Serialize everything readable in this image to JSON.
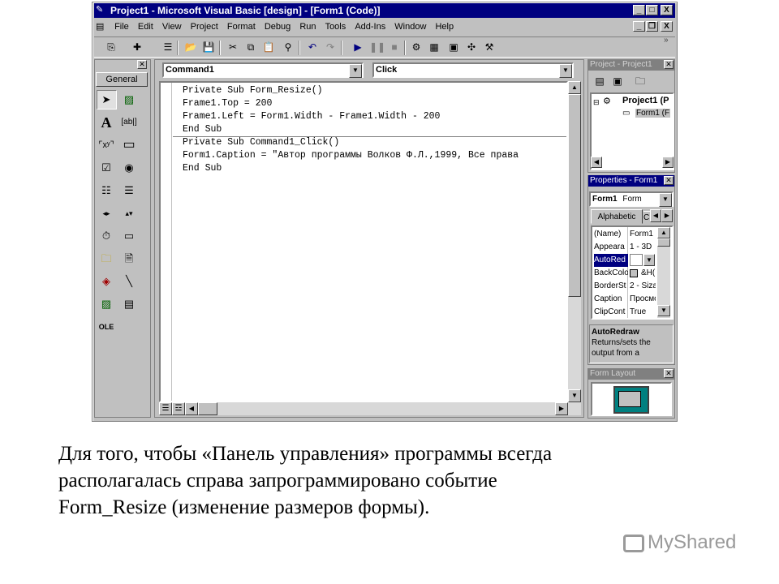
{
  "window": {
    "title": "Project1 - Microsoft Visual Basic [design] - [Form1 (Code)]",
    "controls": [
      "_",
      "□",
      "X"
    ],
    "inner_controls": [
      "_",
      "❐",
      "X"
    ]
  },
  "menu": [
    "File",
    "Edit",
    "View",
    "Project",
    "Format",
    "Debug",
    "Run",
    "Tools",
    "Add-Ins",
    "Window",
    "Help"
  ],
  "toolbox": {
    "tab_label": "General"
  },
  "code_window": {
    "object_combo": "Command1",
    "procedure_combo": "Click",
    "lines": [
      "Private Sub Form_Resize()",
      "Frame1.Top = 200",
      "Frame1.Left = Form1.Width - Frame1.Width - 200",
      "End Sub",
      "Private Sub Command1_Click()",
      "Form1.Caption = \"Автор программы Волков Ф.Л.,1999, Все права",
      "End Sub"
    ]
  },
  "project_explorer": {
    "title": "Project - Project1",
    "root": "Project1 (P",
    "child": "Form1 (F"
  },
  "properties": {
    "title": "Properties - Form1",
    "object_combo": "Form1",
    "object_type": "Form",
    "tab_alphabetic": "Alphabetic",
    "tab_categorized": "C",
    "rows": [
      {
        "name": "(Name)",
        "value": "Form1"
      },
      {
        "name": "Appeara",
        "value": "1 - 3D"
      },
      {
        "name": "AutoRed",
        "value": ""
      },
      {
        "name": "BackColo",
        "value": "&H("
      },
      {
        "name": "BorderSt",
        "value": "2 - Siza"
      },
      {
        "name": "Caption",
        "value": "Просмс"
      },
      {
        "name": "ClipCont",
        "value": "True"
      }
    ],
    "desc_title": "AutoRedraw",
    "desc_line1": "Returns/sets the",
    "desc_line2": "output from a"
  },
  "form_layout": {
    "title": "Form Layout"
  },
  "caption": {
    "line1": "Для того, чтобы «Панель управления» программы всегда",
    "line2": "располагалась справа запрограммировано событие",
    "line3": "Form_Resize (изменение размеров формы)."
  },
  "watermark": "MyShared"
}
